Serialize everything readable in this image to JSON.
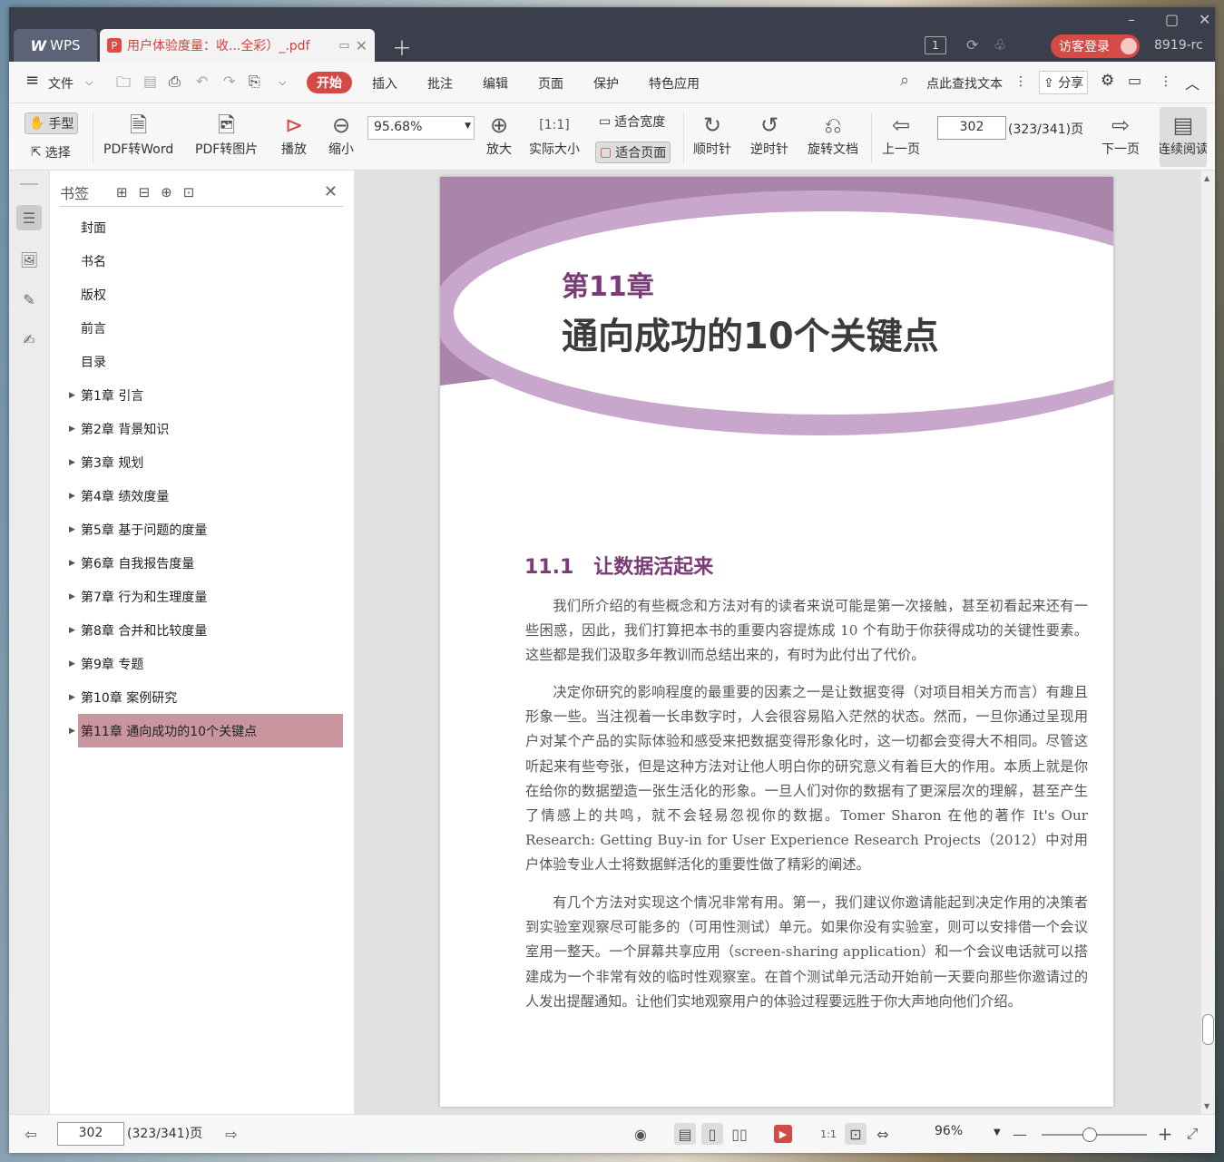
{
  "app": {
    "name": "WPS",
    "tab_title": "用户体验度量：收...全彩）_.pdf",
    "user_badge": "1",
    "login": "访客登录",
    "user_id": "8919-rc"
  },
  "menu": {
    "file": "文件",
    "items": [
      "开始",
      "插入",
      "批注",
      "编辑",
      "页面",
      "保护",
      "特色应用"
    ],
    "search": "点此查找文本",
    "share": "分享"
  },
  "toolbar": {
    "hand": "手型",
    "select": "选择",
    "pdf2word": "PDF转Word",
    "pdf2img": "PDF转图片",
    "play": "播放",
    "zoom_out": "缩小",
    "zoom_value": "95.68%",
    "zoom_in": "放大",
    "actual": "实际大小",
    "fit_width": "适合宽度",
    "fit_page": "适合页面",
    "cw": "顺时针",
    "ccw": "逆时针",
    "rotate": "旋转文档",
    "prev": "上一页",
    "page": "302",
    "page_info": "(323/341)页",
    "next": "下一页",
    "continuous": "连续阅读"
  },
  "bookmarks": {
    "title": "书签",
    "items": [
      {
        "label": "封面",
        "expandable": false
      },
      {
        "label": "书名",
        "expandable": false
      },
      {
        "label": "版权",
        "expandable": false
      },
      {
        "label": "前言",
        "expandable": false
      },
      {
        "label": "目录",
        "expandable": false
      },
      {
        "label": "第1章 引言",
        "expandable": true
      },
      {
        "label": "第2章 背景知识",
        "expandable": true
      },
      {
        "label": "第3章 规划",
        "expandable": true
      },
      {
        "label": "第4章 绩效度量",
        "expandable": true
      },
      {
        "label": "第5章 基于问题的度量",
        "expandable": true
      },
      {
        "label": "第6章 自我报告度量",
        "expandable": true
      },
      {
        "label": "第7章 行为和生理度量",
        "expandable": true
      },
      {
        "label": "第8章 合并和比较度量",
        "expandable": true
      },
      {
        "label": "第9章 专题",
        "expandable": true
      },
      {
        "label": "第10章 案例研究",
        "expandable": true
      },
      {
        "label": "第11章 通向成功的10个关键点",
        "expandable": true,
        "selected": true
      }
    ]
  },
  "document": {
    "chapter_num": "第11章",
    "chapter_title": "通向成功的10个关键点",
    "section": "11.1　让数据活起来",
    "paragraphs": [
      "我们所介绍的有些概念和方法对有的读者来说可能是第一次接触，甚至初看起来还有一些困惑，因此，我们打算把本书的重要内容提炼成 10 个有助于你获得成功的关键性要素。这些都是我们汲取多年教训而总结出来的，有时为此付出了代价。",
      "决定你研究的影响程度的最重要的因素之一是让数据变得（对项目相关方而言）有趣且形象一些。当注视着一长串数字时，人会很容易陷入茫然的状态。然而，一旦你通过呈现用户对某个产品的实际体验和感受来把数据变得形象化时，这一切都会变得大不相同。尽管这听起来有些夸张，但是这种方法对让他人明白你的研究意义有着巨大的作用。本质上就是你在给你的数据塑造一张生活化的形象。一旦人们对你的数据有了更深层次的理解，甚至产生了情感上的共鸣，就不会轻易忽视你的数据。Tomer Sharon 在他的著作 It's Our Research: Getting Buy-in for User Experience Research Projects（2012）中对用户体验专业人士将数据鲜活化的重要性做了精彩的阐述。",
      "有几个方法对实现这个情况非常有用。第一，我们建议你邀请能起到决定作用的决策者到实验室观察尽可能多的（可用性测试）单元。如果你没有实验室，则可以安排借一个会议室用一整天。一个屏幕共享应用（screen-sharing application）和一个会议电话就可以搭建成为一个非常有效的临时性观察室。在首个测试单元活动开始前一天要向那些你邀请过的人发出提醒通知。让他们实地观察用户的体验过程要远胜于你大声地向他们介绍。"
    ]
  },
  "status": {
    "page": "302",
    "page_info": "(323/341)页",
    "zoom": "96%"
  },
  "colors": {
    "accent": "#d44a47",
    "chapter_purple": "#7b3a78",
    "selected_bookmark": "#c9969f"
  }
}
